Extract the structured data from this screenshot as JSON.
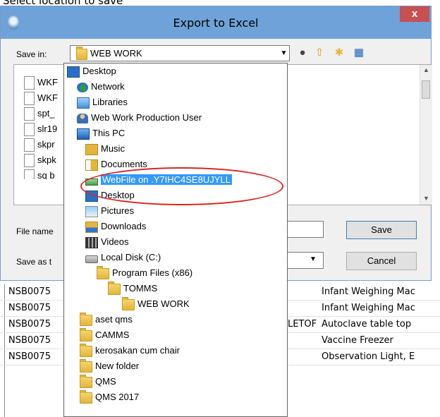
{
  "caption": "Select location to save",
  "background_rows": [
    {
      "code": "NSB0075",
      "mid": "",
      "desc": "Infant Weighing Mac"
    },
    {
      "code": "NSB0075",
      "mid": "",
      "desc": "Infant Weighing Mac"
    },
    {
      "code": "NSB0075",
      "mid": "LETOF",
      "desc": "Autoclave table top"
    },
    {
      "code": "NSB0075",
      "mid": "",
      "desc": "Vaccine Freezer"
    },
    {
      "code": "NSB0075",
      "mid": "",
      "desc": "Observation Light, E"
    }
  ],
  "dialog": {
    "title": "Export to Excel",
    "close_label": "x",
    "save_in_label": "Save in:",
    "save_in_value": "WEB WORK",
    "file_name_label": "File name",
    "save_as_label": "Save as t",
    "save_button": "Save",
    "cancel_button": "Cancel",
    "files": [
      "WKF",
      "WKF",
      "spt_",
      "slr19",
      "skpr",
      "skpk",
      "sq b"
    ]
  },
  "dropdown_items": [
    {
      "label": "Desktop",
      "icon": "desktop-icon",
      "indent": 0
    },
    {
      "label": "Network",
      "icon": "network-icon",
      "indent": 1
    },
    {
      "label": "Libraries",
      "icon": "libraries-icon",
      "indent": 1
    },
    {
      "label": "Web Work Production User",
      "icon": "user-icon",
      "indent": 1
    },
    {
      "label": "This PC",
      "icon": "pc-icon",
      "indent": 1
    },
    {
      "label": "Music",
      "icon": "music-icon",
      "indent": 2
    },
    {
      "label": "Documents",
      "icon": "docs-icon",
      "indent": 2
    },
    {
      "label": "WebFile on .Y7IHC4SE8UJYLL",
      "icon": "netdrive-icon",
      "indent": 2,
      "selected": true
    },
    {
      "label": "Desktop",
      "icon": "desktop-icon",
      "indent": 2
    },
    {
      "label": "Pictures",
      "icon": "pics-icon",
      "indent": 2
    },
    {
      "label": "Downloads",
      "icon": "dl-icon",
      "indent": 2
    },
    {
      "label": "Videos",
      "icon": "video-icon",
      "indent": 2
    },
    {
      "label": "Local Disk (C:)",
      "icon": "disk-icon",
      "indent": 2
    },
    {
      "label": "Program Files (x86)",
      "icon": "folder-icon",
      "indent": 3
    },
    {
      "label": "TOMMS",
      "icon": "folder-icon",
      "indent": 4
    },
    {
      "label": "WEB WORK",
      "icon": "folder-icon",
      "indent": 5
    },
    {
      "label": "aset qms",
      "icon": "folder-icon",
      "indent": 2
    },
    {
      "label": "CAMMS",
      "icon": "folder-icon",
      "indent": 2
    },
    {
      "label": "kerosakan cum chair",
      "icon": "folder-icon",
      "indent": 2
    },
    {
      "label": "New folder",
      "icon": "folder-icon",
      "indent": 2
    },
    {
      "label": "QMS",
      "icon": "folder-icon",
      "indent": 2
    },
    {
      "label": "QMS 2017",
      "icon": "folder-icon",
      "indent": 2
    }
  ]
}
